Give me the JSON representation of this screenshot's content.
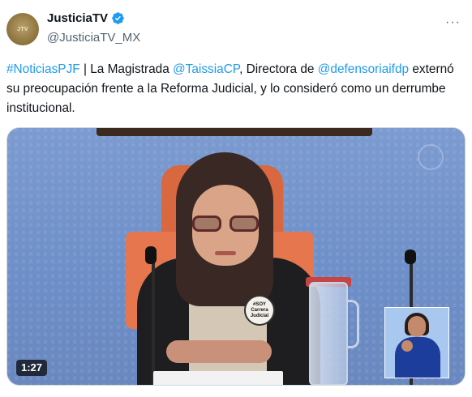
{
  "author": {
    "display_name": "JusticiaTV",
    "handle": "@JusticiaTV_MX",
    "verified": true
  },
  "tweet": {
    "segments": [
      {
        "text": "#NoticiasPJF",
        "link": true
      },
      {
        "text": " | La Magistrada ",
        "link": false
      },
      {
        "text": "@TaissiaCP",
        "link": true
      },
      {
        "text": ", Directora de ",
        "link": false
      },
      {
        "text": "@defensoriaifdp",
        "link": true
      },
      {
        "text": " externó su preocupación frente a la Reforma Judicial, y lo consideró como un derrumbe institucional.",
        "link": false
      }
    ]
  },
  "media": {
    "type": "video",
    "duration": "1:27",
    "pin_text": "#SOY Carrera Judicial"
  },
  "icons": {
    "verified": "verified-badge-icon",
    "more": "more-options-icon"
  },
  "colors": {
    "link": "#1d9bf0",
    "verified": "#1d9bf0",
    "text": "#0f1419",
    "secondary": "#536471"
  }
}
